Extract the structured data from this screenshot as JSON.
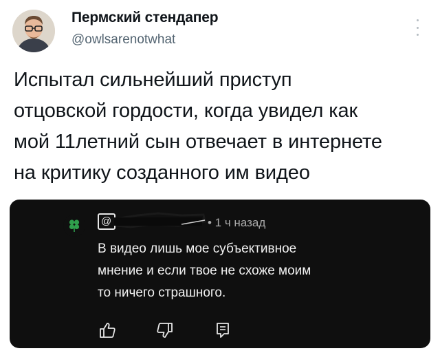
{
  "tweet": {
    "author_name": "Пермский стендапер",
    "author_handle": "@owlsarenotwhat",
    "text": "Испытал сильнейший приступ\nотцовской гордости, когда увидел как\nмой 11летний сын отвечает в интернете\nна критику созданного им видео"
  },
  "embedded_comment": {
    "handle_prefix": "@",
    "time": "• 1 ч назад",
    "text": "В видео лишь мое субъективное\nмнение и если твое не схоже моим\nто ничего страшного.",
    "icons": [
      "like-icon",
      "dislike-icon",
      "reply-icon"
    ]
  },
  "colors": {
    "background": "#ffffff",
    "text": "#0f1419",
    "secondary_text": "#536471",
    "card_background": "#0f0f0f",
    "card_text": "#f1f1f1",
    "card_meta": "#aaaaaa"
  }
}
